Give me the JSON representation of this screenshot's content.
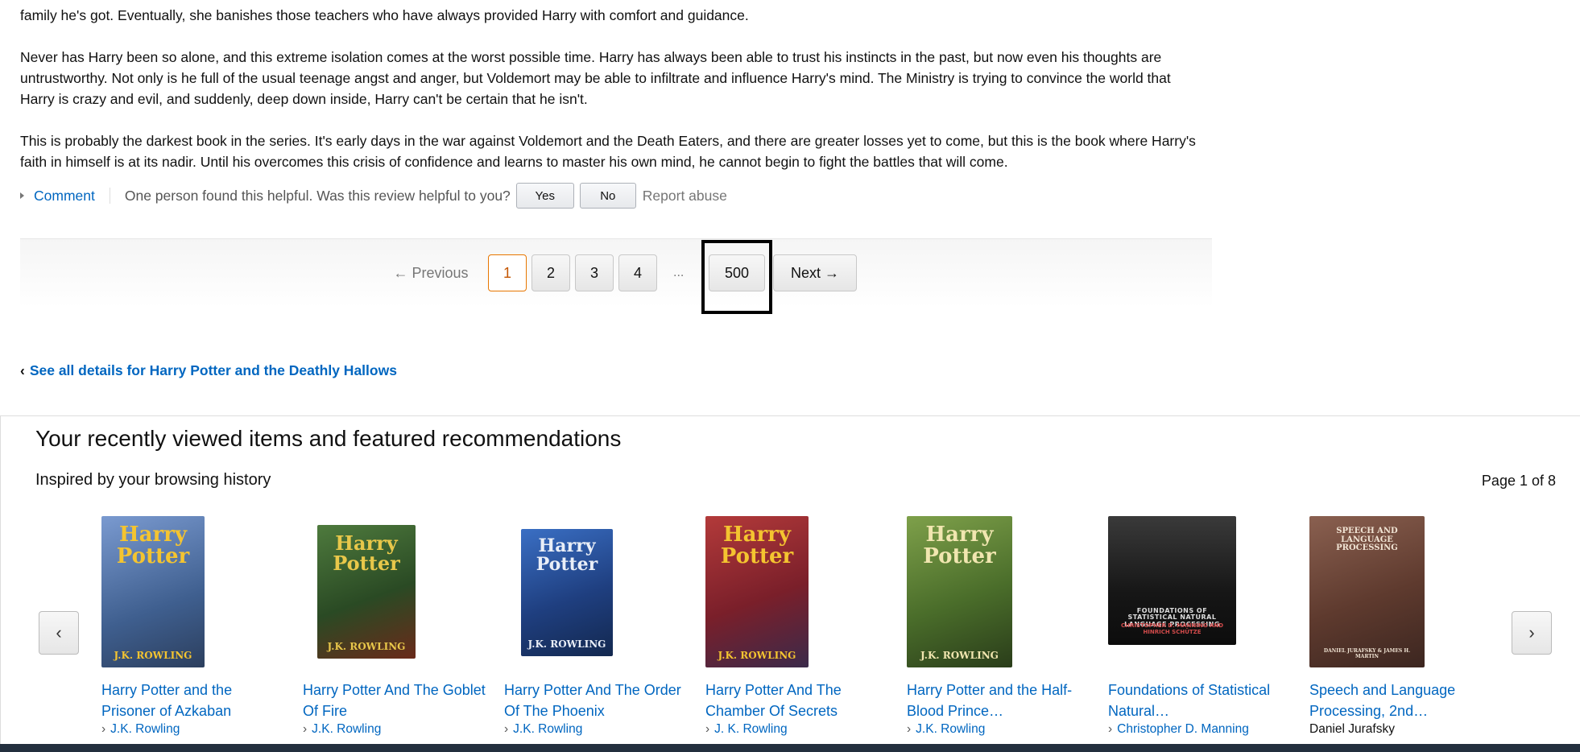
{
  "review": {
    "paragraph_partial": "family he's got. Eventually, she banishes those teachers who have always provided Harry with comfort and guidance.",
    "paragraph_2": "Never has Harry been so alone, and this extreme isolation comes at the worst possible time. Harry has always been able to trust his instincts in the past, but now even his thoughts are untrustworthy. Not only is he full of the usual teenage angst and anger, but Voldemort may be able to infiltrate and influence Harry's mind. The Ministry is trying to convince the world that Harry is crazy and evil, and suddenly, deep down inside, Harry can't be certain that he isn't.",
    "paragraph_3": "This is probably the darkest book in the series. It's early days in the war against Voldemort and the Death Eaters, and there are greater losses yet to come, but this is the book where Harry's faith in himself is at its nadir. Until his overcomes this crisis of confidence and learns to master his own mind, he cannot begin to fight the battles that will come."
  },
  "feedback": {
    "comment_label": "Comment",
    "helpful_text": "One person found this helpful. Was this review helpful to you?",
    "yes_label": "Yes",
    "no_label": "No",
    "report_label": "Report abuse"
  },
  "pagination": {
    "previous_label": "← Previous",
    "pages": [
      "1",
      "2",
      "3",
      "4"
    ],
    "current_page": "1",
    "ellipsis": "...",
    "last_page": "500",
    "next_label": "Next →"
  },
  "see_all": {
    "prefix": "‹",
    "label": "See all details for Harry Potter and the Deathly Hallows"
  },
  "recommendations": {
    "title": "Your recently viewed items and featured recommendations",
    "subtitle": "Inspired by your browsing history",
    "page_indicator": "Page 1 of 8",
    "prev_arrow": "‹",
    "next_arrow": "›",
    "items": [
      {
        "title": "Harry Potter and the Prisoner of Azkaban",
        "author": "J.K. Rowling",
        "cover_text": "Harry Potter",
        "cover_author": "J.K. ROWLING",
        "cover_color": "#5b7fb6",
        "stars": "★★★★★"
      },
      {
        "title": "Harry Potter And The Goblet Of Fire",
        "author": "J.K. Rowling",
        "cover_text": "Harry Potter",
        "cover_author": "J.K. ROWLING",
        "cover_color": "#2e5a2f",
        "stars": "★★★★★"
      },
      {
        "title": "Harry Potter And The Order Of The Phoenix",
        "author": "J.K. Rowling",
        "cover_text": "Harry Potter",
        "cover_author": "J.K. ROWLING",
        "cover_color": "#1f4e9a",
        "stars": "★★★★★"
      },
      {
        "title": "Harry Potter And The Chamber Of Secrets",
        "author": "J. K. Rowling",
        "cover_text": "Harry Potter",
        "cover_author": "J.K. ROWLING",
        "cover_color": "#9b2a2a",
        "stars": "★★★★★"
      },
      {
        "title": "Harry Potter and the Half-Blood Prince…",
        "author": "J.K. Rowling",
        "cover_text": "Harry Potter",
        "cover_author": "J.K. ROWLING",
        "cover_color": "#5f8a3a",
        "stars": "★★★★★"
      },
      {
        "title": "Foundations of Statistical Natural…",
        "author": "Christopher D. Manning",
        "cover_text": "FOUNDATIONS OF STATISTICAL NATURAL LANGUAGE PROCESSING",
        "cover_author": "CHRISTOPHER D. MANNING AND HINRICH SCHÜTZE",
        "cover_color": "#1c1c1c",
        "stars": "★★★★☆"
      },
      {
        "title": "Speech and Language Processing, 2nd…",
        "author": "Daniel Jurafsky",
        "cover_text": "SPEECH AND LANGUAGE PROCESSING",
        "cover_author": "DANIEL JURAFSKY & JAMES H. MARTIN",
        "cover_color": "#6e4a3c",
        "stars": "★★★★☆"
      }
    ]
  },
  "colors": {
    "link": "#0066c0",
    "current_page_border": "#e77600",
    "star": "#ffa41c"
  }
}
